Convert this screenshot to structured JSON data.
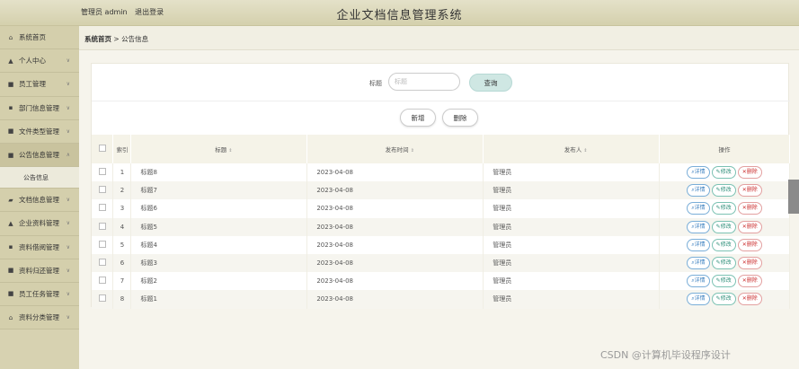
{
  "header": {
    "user_label": "管理员 admin",
    "logout_label": "退出登录",
    "system_title": "企业文档信息管理系统"
  },
  "sidebar": {
    "items": [
      {
        "label": "系统首页",
        "icon": "home-icon"
      },
      {
        "label": "个人中心",
        "icon": "person-icon"
      },
      {
        "label": "员工管理",
        "icon": "grid-icon"
      },
      {
        "label": "部门信息管理",
        "icon": "square-icon"
      },
      {
        "label": "文件类型管理",
        "icon": "grid-icon"
      },
      {
        "label": "公告信息管理",
        "icon": "grid-icon"
      },
      {
        "label": "公告信息",
        "icon": ""
      },
      {
        "label": "文档信息管理",
        "icon": "folder-icon"
      },
      {
        "label": "企业资料管理",
        "icon": "person-icon"
      },
      {
        "label": "资料借阅管理",
        "icon": "square-icon"
      },
      {
        "label": "资料归还管理",
        "icon": "grid-icon"
      },
      {
        "label": "员工任务管理",
        "icon": "grid-icon"
      },
      {
        "label": "资料分类管理",
        "icon": "hat-icon"
      }
    ]
  },
  "breadcrumb": {
    "home": "系统首页",
    "sep": ">",
    "current": "公告信息"
  },
  "search": {
    "label": "标题",
    "placeholder": "标题",
    "query_label": "查询"
  },
  "actions": {
    "add_label": "新增",
    "delete_label": "删除"
  },
  "table": {
    "headers": {
      "index": "索引",
      "title": "标题",
      "time": "发布时间",
      "publisher": "发布人",
      "ops": "操作"
    },
    "op_labels": {
      "detail": "详情",
      "edit": "修改",
      "delete": "删除"
    },
    "rows": [
      {
        "index": "1",
        "title": "标题8",
        "time": "2023-04-08",
        "publisher": "管理员"
      },
      {
        "index": "2",
        "title": "标题7",
        "time": "2023-04-08",
        "publisher": "管理员"
      },
      {
        "index": "3",
        "title": "标题6",
        "time": "2023-04-08",
        "publisher": "管理员"
      },
      {
        "index": "4",
        "title": "标题5",
        "time": "2023-04-08",
        "publisher": "管理员"
      },
      {
        "index": "5",
        "title": "标题4",
        "time": "2023-04-08",
        "publisher": "管理员"
      },
      {
        "index": "6",
        "title": "标题3",
        "time": "2023-04-08",
        "publisher": "管理员"
      },
      {
        "index": "7",
        "title": "标题2",
        "time": "2023-04-08",
        "publisher": "管理员"
      },
      {
        "index": "8",
        "title": "标题1",
        "time": "2023-04-08",
        "publisher": "管理员"
      }
    ]
  },
  "watermark": "CSDN @计算机毕设程序设计",
  "colors": {
    "topbar": "#d4d0ad",
    "sidebar": "#d4cfac",
    "query_button": "#cfe7e3",
    "detail": "#3a7fbf",
    "edit": "#2f8f7a",
    "delete": "#cc3333"
  }
}
